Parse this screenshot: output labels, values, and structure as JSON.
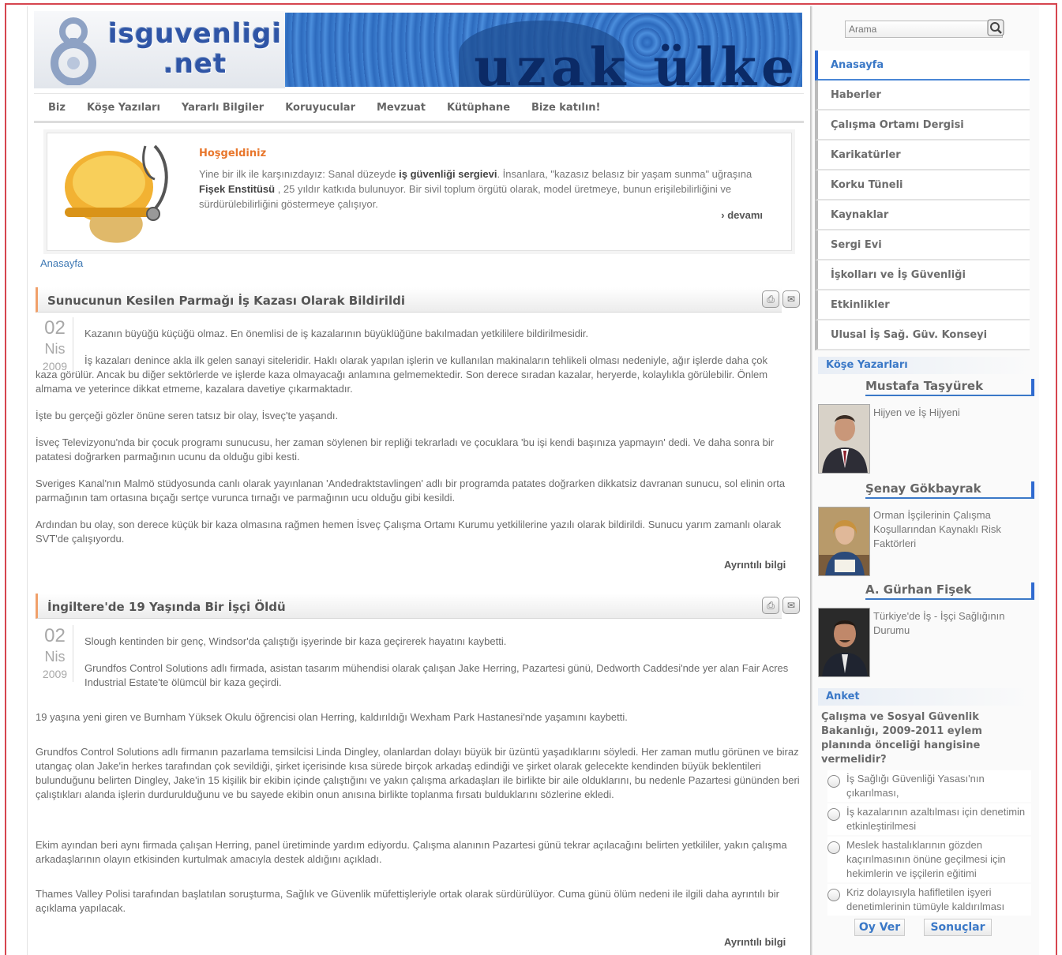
{
  "logo": {
    "line1": "isguvenligi",
    "line2": ".net"
  },
  "banner": {
    "text": "uzak ülke"
  },
  "nav": [
    "Biz",
    "Köşe Yazıları",
    "Yararlı Bilgiler",
    "Koruyucular",
    "Mevzuat",
    "Kütüphane",
    "Bize katılın!"
  ],
  "welcome": {
    "title": "Hoşgeldiniz",
    "text_parts": [
      "Yine bir ilk ile karşınızdayız: Sanal düzeyde ",
      "iş güvenliği sergievi",
      ". İnsanlara, \"kazasız belasız bir yaşam sunma\" uğraşına ",
      "Fişek Enstitüsü",
      " , 25 yıldır katkıda bulunuyor. Bir sivil toplum örgütü olarak, model üretmeye, bunun erişilebilirliğini ve sürdürülebilirliğini göstermeye çalışıyor."
    ],
    "more": "› devamı"
  },
  "breadcrumb": "Anasayfa",
  "articles": [
    {
      "title": "Sunucunun Kesilen Parmağı İş Kazası Olarak Bildirildi",
      "day": "02",
      "month": "Nis",
      "year": "2009",
      "lead": "Kazanın büyüğü küçüğü olmaz. En önemlisi de iş kazalarının büyüklüğüne bakılmadan yetkililere bildirilmesidir.",
      "paragraphs": [
        "İş kazaları denince akla ilk gelen sanayi siteleridir. Haklı olarak yapılan işlerin ve kullanılan makinaların tehlikeli olması nedeniyle, ağır işlerde daha çok kaza görülür. Ancak bu diğer sektörlerde ve işlerde kaza olmayacağı anlamına gelmemektedir. Son derece sıradan kazalar, heryerde, kolaylıkla görülebilir. Önlem almama ve yeterince dikkat etmeme, kazalara davetiye çıkarmaktadır.",
        "İşte bu gerçeği gözler önüne seren tatsız bir olay, İsveç'te yaşandı.",
        "İsveç Televizyonu'nda bir çocuk programı sunucusu, her zaman söylenen bir repliği tekrarladı ve çocuklara 'bu işi kendi başınıza yapmayın' dedi. Ve daha sonra bir patatesi doğrarken parmağının ucunu da olduğu gibi kesti.",
        "Sveriges Kanal'nın Malmö stüdyosunda canlı olarak yayınlanan 'Andedraktstavlingen' adlı bir programda patates doğrarken dikkatsiz davranan sunucu, sol elinin orta parmağının tam ortasına bıçağı sertçe vurunca tırnağı ve parmağının ucu olduğu gibi kesildi.",
        "Ardından bu olay, son derece küçük bir kaza olmasına rağmen hemen İsveç Çalışma Ortamı Kurumu yetkililerine yazılı olarak bildirildi. Sunucu yarım zamanlı olarak SVT'de çalışıyordu."
      ],
      "more": "Ayrıntılı bilgi"
    },
    {
      "title": "İngiltere'de 19 Yaşında Bir İşçi Öldü",
      "day": "02",
      "month": "Nis",
      "year": "2009",
      "lead": "Slough kentinden bir genç, Windsor'da çalıştığı işyerinde bir kaza geçirerek hayatını kaybetti.",
      "paragraphs": [
        "Grundfos Control Solutions adlı firmada, asistan tasarım mühendisi olarak çalışan Jake Herring, Pazartesi günü, Dedworth Caddesi'nde yer alan Fair Acres Industrial Estate'te ölümcül bir kaza geçirdi.",
        "19 yaşına yeni giren ve Burnham Yüksek Okulu öğrencisi olan Herring, kaldırıldığı Wexham Park Hastanesi'nde yaşamını kaybetti.",
        "Grundfos Control Solutions adlı firmanın pazarlama temsilcisi Linda Dingley, olanlardan dolayı büyük bir üzüntü yaşadıklarını söyledi. Her zaman mutlu görünen ve biraz utangaç olan Jake'in herkes tarafından çok sevildiği, şirket içerisinde kısa sürede birçok arkadaş edindiği ve şirket olarak gelecekte kendinden büyük beklentileri bulunduğunu belirten Dingley, Jake'in 15 kişilik bir ekibin içinde çalıştığını ve yakın çalışma arkadaşları ile birlikte bir aile olduklarını, bu nedenle Pazartesi gününden beri çalıştıkları alanda işlerin durdurulduğunu ve bu sayede ekibin onun anısına birlikte toplanma fırsatı bulduklarını sözlerine ekledi.",
        "Ekim ayından beri aynı firmada çalışan Herring, panel üretiminde yardım ediyordu. Çalışma alanının Pazartesi günü tekrar açılacağını belirten yetkililer, yakın çalışma arkadaşlarının olayın etkisinden kurtulmak amacıyla destek aldığını açıkladı.",
        "Thames Valley Polisi tarafından başlatılan soruşturma, Sağlık ve Güvenlik müfettişleriyle ortak olarak sürdürülüyor. Cuma günü ölüm nedeni ile ilgili daha ayrıntılı bir açıklama yapılacak."
      ],
      "more": "Ayrıntılı bilgi"
    }
  ],
  "sidebar": {
    "search_placeholder": "Arama",
    "menu": [
      "Anasayfa",
      "Haberler",
      "Çalışma Ortamı Dergisi",
      "Karikatürler",
      "Korku Tüneli",
      "Kaynaklar",
      "Sergi Evi",
      "İşkolları ve İş Güvenliği",
      "Etkinlikler",
      "Ulusal İş Sağ. Güv. Konseyi"
    ],
    "columns_title": "Köşe Yazarları",
    "authors": [
      {
        "name": "Mustafa Taşyürek",
        "article": "Hijyen ve İş Hijyeni"
      },
      {
        "name": "Şenay Gökbayrak",
        "article": "Orman İşçilerinin Çalışma Koşullarından Kaynaklı Risk Faktörleri"
      },
      {
        "name": "A. Gürhan Fişek",
        "article": "Türkiye'de İş - İşçi Sağlığının Durumu"
      }
    ],
    "poll": {
      "title": "Anket",
      "question": "Çalışma ve Sosyal Güvenlik Bakanlığı, 2009-2011 eylem planında önceliği hangisine vermelidir?",
      "options": [
        "İş Sağlığı Güvenliği Yasası'nın çıkarılması,",
        "İş kazalarının azaltılması için denetimin etkinleştirilmesi",
        "Meslek hastalıklarının gözden kaçırılmasının önüne geçilmesi için hekimlerin ve işçilerin eğitimi",
        "Kriz dolayısıyla hafifletilen işyeri denetimlerinin tümüyle kaldırılması"
      ],
      "vote_label": "Oy Ver",
      "results_label": "Sonuçlar"
    }
  }
}
